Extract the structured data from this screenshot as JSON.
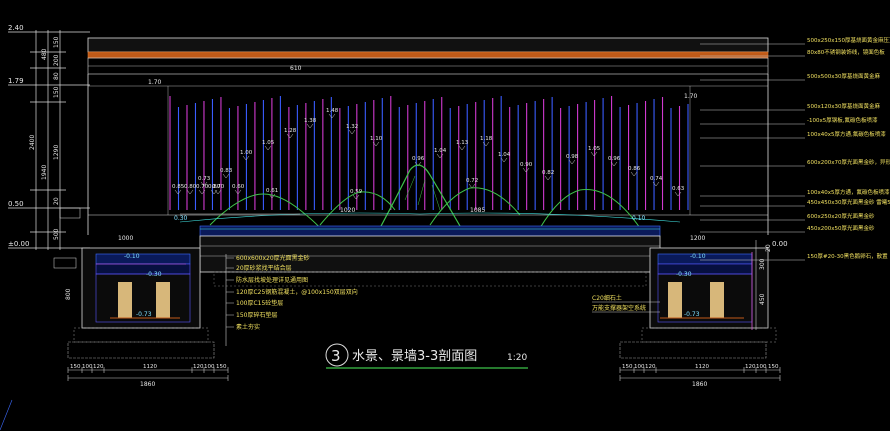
{
  "title": {
    "number": "3",
    "text": "水景、景墙3-3剖面图",
    "scale": "1:20"
  },
  "elevations": [
    {
      "label": "2.40"
    },
    {
      "label": "1.79"
    },
    {
      "label": "0.50"
    },
    {
      "label": "±0.00"
    }
  ],
  "left_dims": [
    "480",
    "150",
    "200",
    "80",
    "150",
    "1290",
    "2400",
    "1940",
    "20",
    "500"
  ],
  "stick_labels": [
    "0.85",
    "0.80",
    "0.70",
    "0.80",
    "0.73",
    "0.70",
    "0.83",
    "0.60",
    "1.00",
    "1.05",
    "1.28",
    "1.38",
    "1.48",
    "0.59",
    "1.32",
    "1.10",
    "0.96",
    "1.04",
    "1.13",
    "1.18",
    "0.72",
    "1.04",
    "0.90",
    "0.82",
    "0.98",
    "1.05",
    "0.96",
    "0.86",
    "0.74",
    "0.63",
    "0.61"
  ],
  "top_right_level": "1.70",
  "top_right_level2": "1.70",
  "mid_dims": {
    "d620": "610",
    "d1020": "1020",
    "d1400": "1400",
    "d1085": "1085",
    "d960": "960",
    "d1000": "1000",
    "d1200": "1200"
  },
  "water_levels": [
    "-0.30",
    "-0.30",
    "-0.10",
    "-0.10",
    "-0.73",
    "-0.73",
    "0.30",
    "0.10",
    "0.00"
  ],
  "right_annotations": [
    "500x250x150厚基烧面黄金麻压顶",
    "80x80不锈钢装饰线，镜面色板",
    "500x500x30厚基烧面黄金麻",
    "500x120x30厚基烧面黄金麻",
    "-100x5厚钢板,氟碳色板喷漆",
    "100x40x5厚方通,氟碳色板喷漆",
    "600x200x70厚光面黑金砂，异形加工",
    "100x40x5厚方通，氟碳色板喷漆",
    "450x450x30厚光面黑金砂 雷曦5mm",
    "600x250x20厚光面黑金砂",
    "450x200x50厚光面黑金砂",
    "150厚#20-30黑色鹅卵石，散置"
  ],
  "left_notes": [
    "600x600x20厚光面黑金砂",
    "20厚砂浆找平结合层",
    "防水层找坡处理详见通用图",
    "120厚C25钢筋混凝土，@100x150双层双向",
    "100厚C15砼垫层",
    "150厚碎石垫层",
    "素土夯实"
  ],
  "right_notes": [
    "C20细石土",
    "万能支撑器架空系统"
  ],
  "bottom_dims_left": [
    "150",
    "100",
    "120",
    "1120",
    "120",
    "100",
    "150"
  ],
  "bottom_dims_right": [
    "150",
    "100",
    "120",
    "1120",
    "120",
    "100",
    "150"
  ],
  "bottom_total": "1860",
  "right_dims": [
    "20",
    "300",
    "150",
    "450",
    "100"
  ],
  "left_depth": [
    "800",
    "1040"
  ]
}
